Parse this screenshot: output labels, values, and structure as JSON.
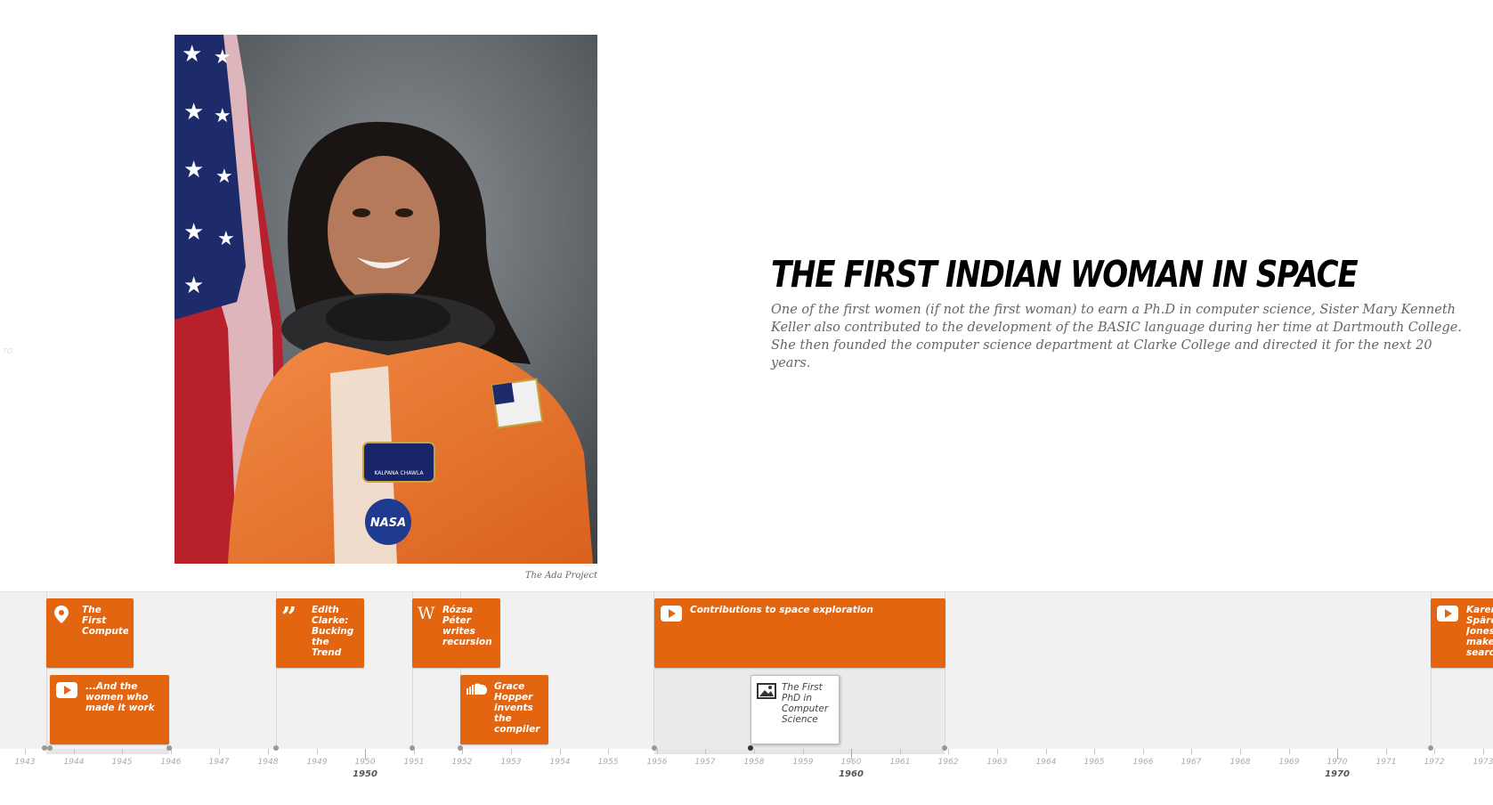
{
  "slide": {
    "headline": "THE FIRST INDIAN WOMAN IN SPACE",
    "description": "One of the first women (if not the first woman) to earn a Ph.D in computer science, Sister Mary Kenneth Keller also contributed to the development of the BASIC language during her time at Dartmouth College. She then founded the computer science department at Clarke College and directed it for the next 20 years.",
    "photo_credit": "The Ada Project",
    "name_tag": "KALPANA CHAWLA",
    "patch_text": "NASA"
  },
  "side_mark": "TO",
  "colors": {
    "accent": "#e3650f",
    "timeline_bg": "#f1f1f1"
  },
  "timeline": {
    "markers": [
      {
        "title": "The First Computer",
        "icon": "map-pin-icon"
      },
      {
        "title": "...And the women who made it work",
        "icon": "youtube-icon"
      },
      {
        "title": "Edith Clarke: Bucking the Trend",
        "icon": "quote-icon"
      },
      {
        "title": "Rózsa Péter writes recursion",
        "icon": "wikipedia-icon"
      },
      {
        "title": "Grace Hopper invents the compiler",
        "icon": "soundcloud-icon"
      },
      {
        "title": "Contributions to space exploration",
        "icon": "youtube-icon"
      },
      {
        "title": "The First PhD in Computer Science",
        "icon": "image-icon"
      },
      {
        "title": "Karen Spärck Jones makes search...",
        "icon": "youtube-icon"
      }
    ],
    "years": [
      "1943",
      "1944",
      "1945",
      "1946",
      "1947",
      "1948",
      "1949",
      "1950",
      "1951",
      "1952",
      "1953",
      "1954",
      "1955",
      "1956",
      "1957",
      "1958",
      "1959",
      "1960",
      "1961",
      "1962",
      "1963",
      "1964",
      "1965",
      "1966",
      "1967",
      "1968",
      "1969",
      "1970",
      "1971",
      "1972",
      "1973"
    ],
    "major_years": [
      "1950",
      "1960",
      "1970"
    ]
  }
}
